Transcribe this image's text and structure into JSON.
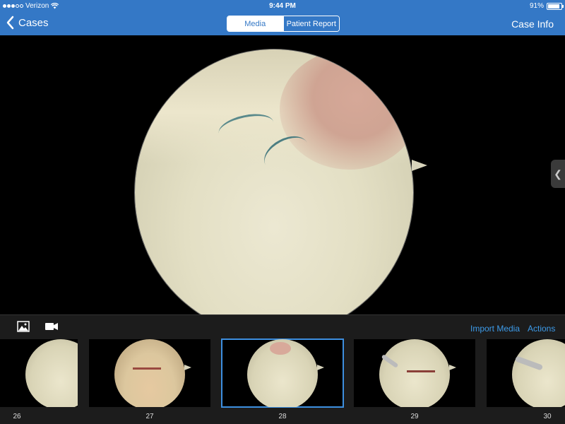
{
  "status_bar": {
    "carrier": "Verizon",
    "time": "9:44 PM",
    "battery_percent": "91%",
    "battery_level": 0.91
  },
  "nav": {
    "back_label": "Cases",
    "segments": [
      "Media",
      "Patient Report"
    ],
    "active_segment": "Media",
    "right_label": "Case Info"
  },
  "toolbar": {
    "photo_icon": "photo-icon",
    "video_icon": "video-camera-icon",
    "import_label": "Import Media",
    "actions_label": "Actions",
    "link_color": "#3d9be9"
  },
  "thumbnails": [
    {
      "label": "26"
    },
    {
      "label": "27"
    },
    {
      "label": "28",
      "selected": true
    },
    {
      "label": "29"
    },
    {
      "label": "30"
    }
  ],
  "colors": {
    "brand": "#3478c6",
    "selection": "#3d8fe0"
  }
}
